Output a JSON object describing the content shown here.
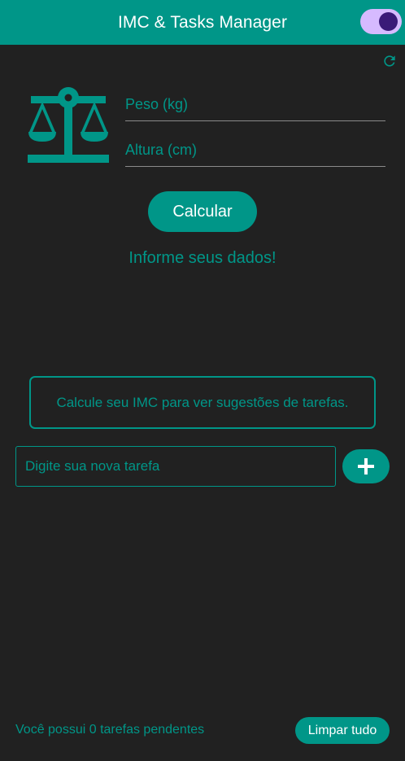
{
  "app_bar": {
    "title": "IMC & Tasks Manager",
    "theme_toggle_on": true
  },
  "icons": {
    "refresh": "refresh-icon",
    "scale": "scale-icon",
    "add": "plus-icon"
  },
  "imc_form": {
    "peso_placeholder": "Peso (kg)",
    "altura_placeholder": "Altura (cm)",
    "calc_label": "Calcular",
    "result_text": "Informe seus dados!"
  },
  "suggestions": {
    "message": "Calcule seu IMC para ver sugestões de tarefas."
  },
  "tasks": {
    "input_placeholder": "Digite sua nova tarefa",
    "pending_text": "Você possui 0 tarefas pendentes",
    "clear_label": "Limpar tudo"
  },
  "colors": {
    "accent": "#009688",
    "background": "#212121",
    "toggle_track": "#d6baff",
    "toggle_knob": "#3a1a78"
  }
}
